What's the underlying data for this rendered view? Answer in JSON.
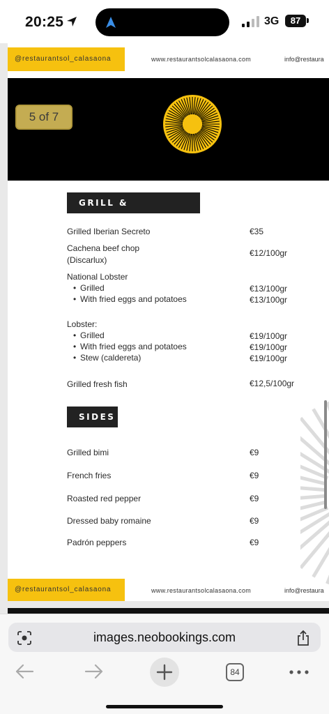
{
  "status_bar": {
    "time": "20:25",
    "network": "3G",
    "battery": "87"
  },
  "document": {
    "page_indicator": "5 of 7",
    "header": {
      "handle": "@restaurantsol_calasaona",
      "website": "www.restaurantsolcalasaona.com",
      "email": "info@restaura"
    },
    "sections": {
      "grill": {
        "title": "GRILL & TRADITION",
        "items": [
          {
            "name": "Grilled Iberian Secreto",
            "price": "€35"
          },
          {
            "name_line1": "Cachena beef chop",
            "name_line2": "(Discarlux)",
            "price": "€12/100gr"
          },
          {
            "name": "National Lobster",
            "subs": [
              {
                "name": "Grilled",
                "price": "€13/100gr"
              },
              {
                "name": "With fried eggs and potatoes",
                "price": "€13/100gr"
              }
            ]
          },
          {
            "name": "Lobster:",
            "subs": [
              {
                "name": "Grilled",
                "price": "€19/100gr"
              },
              {
                "name": "With fried eggs and potatoes",
                "price": "€19/100gr"
              },
              {
                "name": "Stew (caldereta)",
                "price": "€19/100gr"
              }
            ]
          },
          {
            "name": "Grilled fresh fish",
            "price": "€12,5/100gr"
          }
        ]
      },
      "sides": {
        "title": "SIDES",
        "items": [
          {
            "name": "Grilled bimi",
            "price": "€9"
          },
          {
            "name": "French fries",
            "price": "€9"
          },
          {
            "name": "Roasted red pepper",
            "price": "€9"
          },
          {
            "name": "Dressed baby romaine",
            "price": "€9"
          },
          {
            "name": "Padrón peppers",
            "price": "€9"
          }
        ]
      }
    },
    "footer": {
      "handle": "@restaurantsol_calasaona",
      "website": "www.restaurantsolcalasaona.com",
      "email": "info@restaura"
    }
  },
  "browser": {
    "url": "images.neobookings.com",
    "tabs_count": "84"
  },
  "colors": {
    "brand_yellow": "#f6c10f",
    "section_bg": "#222222",
    "band_black": "#000000"
  }
}
